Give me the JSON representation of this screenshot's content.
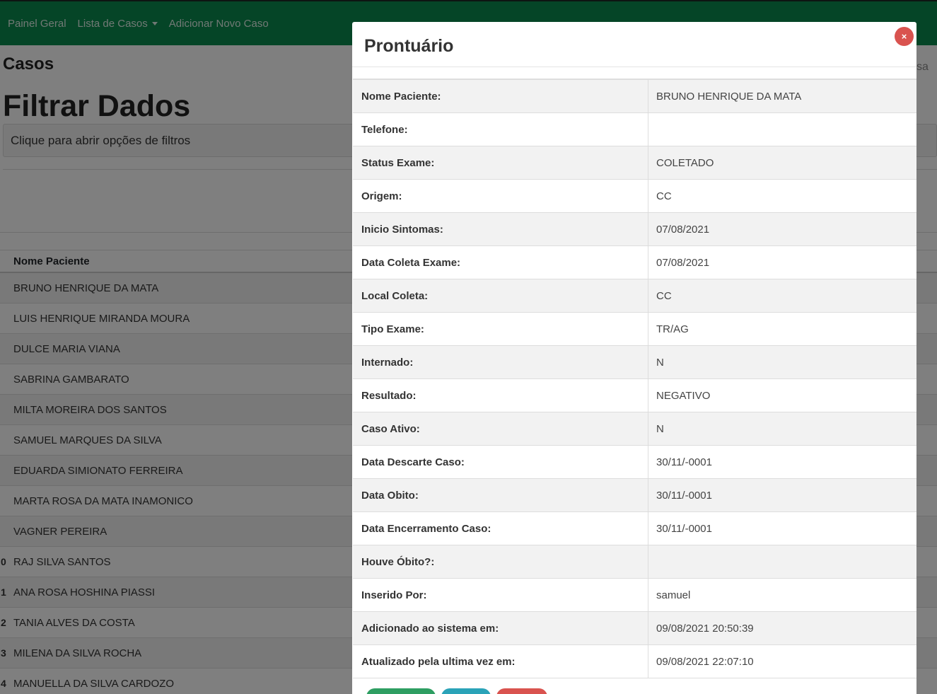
{
  "nav": {
    "painel": "Painel Geral",
    "lista": "Lista de Casos",
    "adicionar": "Adicionar Novo Caso"
  },
  "page": {
    "heading": "Casos",
    "filter_title": "Filtrar Dados",
    "filter_box": "Clique para abrir opções de filtros",
    "search_fragment": "sa"
  },
  "table": {
    "header_name": "Nome Paciente",
    "rows": [
      {
        "idx": "",
        "name": "BRUNO HENRIQUE DA MATA"
      },
      {
        "idx": "",
        "name": "LUIS HENRIQUE MIRANDA MOURA"
      },
      {
        "idx": "",
        "name": "DULCE MARIA VIANA"
      },
      {
        "idx": "",
        "name": "SABRINA GAMBARATO"
      },
      {
        "idx": "",
        "name": "MILTA MOREIRA DOS SANTOS"
      },
      {
        "idx": "",
        "name": "SAMUEL MARQUES DA SILVA"
      },
      {
        "idx": "",
        "name": "EDUARDA SIMIONATO FERREIRA"
      },
      {
        "idx": "",
        "name": "MARTA ROSA DA MATA INAMONICO"
      },
      {
        "idx": "",
        "name": "VAGNER PEREIRA"
      },
      {
        "idx": "0",
        "name": "RAJ SILVA SANTOS"
      },
      {
        "idx": "1",
        "name": "ANA ROSA HOSHINA PIASSI"
      },
      {
        "idx": "2",
        "name": "TANIA ALVES DA COSTA"
      },
      {
        "idx": "3",
        "name": "MILENA DA SILVA ROCHA"
      },
      {
        "idx": "4",
        "name": "MANUELLA DA SILVA CARDOZO"
      }
    ]
  },
  "modal": {
    "title": "Prontuário",
    "close": "×",
    "fields": [
      {
        "label": "Nome Paciente:",
        "value": "BRUNO HENRIQUE DA MATA"
      },
      {
        "label": "Telefone:",
        "value": ""
      },
      {
        "label": "Status Exame:",
        "value": "COLETADO"
      },
      {
        "label": "Origem:",
        "value": "CC"
      },
      {
        "label": "Inicio Sintomas:",
        "value": "07/08/2021"
      },
      {
        "label": "Data Coleta Exame:",
        "value": "07/08/2021"
      },
      {
        "label": "Local Coleta:",
        "value": "CC"
      },
      {
        "label": "Tipo Exame:",
        "value": "TR/AG"
      },
      {
        "label": "Internado:",
        "value": "N"
      },
      {
        "label": "Resultado:",
        "value": "NEGATIVO"
      },
      {
        "label": "Caso Ativo:",
        "value": "N"
      },
      {
        "label": "Data Descarte Caso:",
        "value": "30/11/-0001"
      },
      {
        "label": "Data Obito:",
        "value": "30/11/-0001"
      },
      {
        "label": "Data Encerramento Caso:",
        "value": "30/11/-0001"
      },
      {
        "label": "Houve Óbito?:",
        "value": ""
      },
      {
        "label": "Inserido Por:",
        "value": "samuel"
      },
      {
        "label": "Adicionado ao sistema em:",
        "value": "09/08/2021 20:50:39"
      },
      {
        "label": "Atualizado pela ultima vez em:",
        "value": "09/08/2021 22:07:10"
      }
    ]
  },
  "colors": {
    "nav_green": "#0a8a4f",
    "close_red": "#d9534f"
  }
}
